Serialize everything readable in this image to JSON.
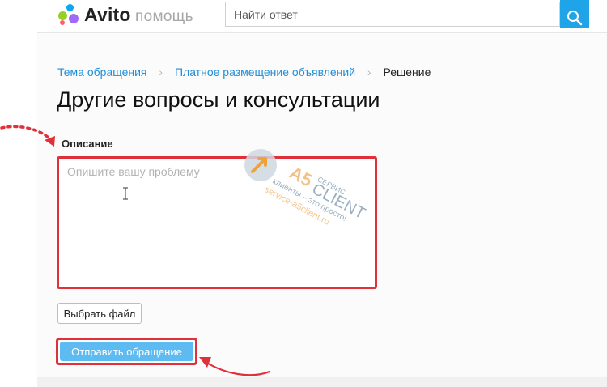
{
  "header": {
    "brand": "Avito",
    "section": "помощь",
    "search_placeholder": "Найти ответ",
    "search_button_icon": "search-icon",
    "accent_color": "#1fa4e8"
  },
  "breadcrumb": [
    {
      "label": "Тема обращения"
    },
    {
      "label": "Платное размещение объявлений"
    },
    {
      "label": "Решение"
    }
  ],
  "page_title": "Другие вопросы и консультации",
  "form": {
    "description_label": "Описание",
    "description_placeholder": "Опишите вашу проблему",
    "description_value": "",
    "file_button": "Выбрать файл",
    "submit_button": "Отправить обращение"
  },
  "watermark": {
    "a5": "A5",
    "service": "СЕРВИС",
    "client": "CLIENT",
    "tagline": "клиенты – это просто!",
    "site": "service-a5client.ru"
  },
  "annotation_color": "#e0313b"
}
